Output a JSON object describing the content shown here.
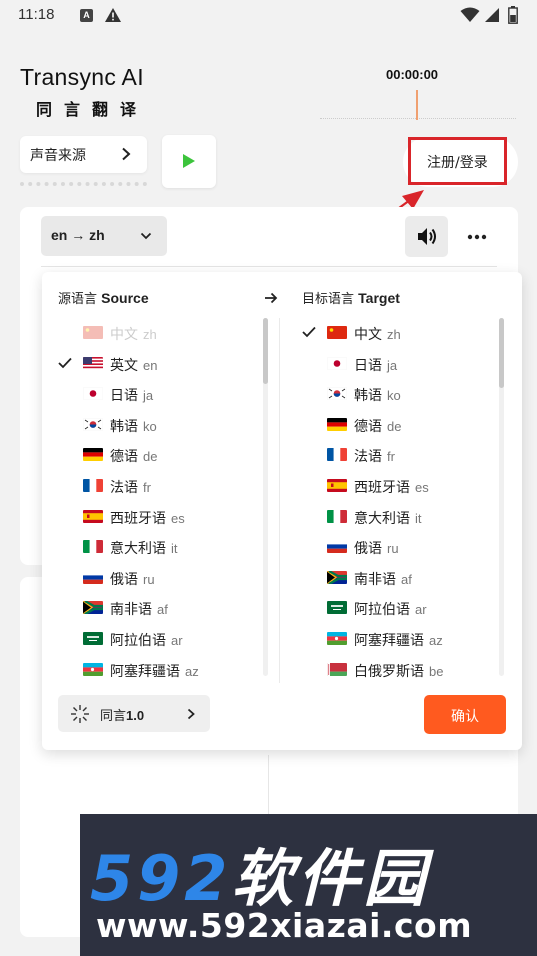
{
  "status_bar": {
    "time": "11:18",
    "notification_badge": "A",
    "icons": [
      "a-badge-icon",
      "warning-icon",
      "wifi-icon",
      "signal-icon",
      "battery-icon"
    ]
  },
  "header": {
    "title": "Transync AI",
    "subtitle": "同言翻译",
    "timer": "00:00:00"
  },
  "controls": {
    "audio_source_label": "声音来源",
    "login_label": "注册/登录"
  },
  "translation_card": {
    "language_pair": "en → zh"
  },
  "dropdown": {
    "source_heading_cn": "源语言",
    "source_heading_en": "Source",
    "target_heading_cn": "目标语言",
    "target_heading_en": "Target",
    "source_languages": [
      {
        "name": "中文",
        "code": "zh",
        "flag": "cn",
        "disabled": true,
        "selected": false
      },
      {
        "name": "英文",
        "code": "en",
        "flag": "us",
        "disabled": false,
        "selected": true
      },
      {
        "name": "日语",
        "code": "ja",
        "flag": "jp",
        "disabled": false,
        "selected": false
      },
      {
        "name": "韩语",
        "code": "ko",
        "flag": "kr",
        "disabled": false,
        "selected": false
      },
      {
        "name": "德语",
        "code": "de",
        "flag": "de",
        "disabled": false,
        "selected": false
      },
      {
        "name": "法语",
        "code": "fr",
        "flag": "fr",
        "disabled": false,
        "selected": false
      },
      {
        "name": "西班牙语",
        "code": "es",
        "flag": "es",
        "disabled": false,
        "selected": false
      },
      {
        "name": "意大利语",
        "code": "it",
        "flag": "it",
        "disabled": false,
        "selected": false
      },
      {
        "name": "俄语",
        "code": "ru",
        "flag": "ru",
        "disabled": false,
        "selected": false
      },
      {
        "name": "南非语",
        "code": "af",
        "flag": "za",
        "disabled": false,
        "selected": false
      },
      {
        "name": "阿拉伯语",
        "code": "ar",
        "flag": "sa",
        "disabled": false,
        "selected": false
      },
      {
        "name": "阿塞拜疆语",
        "code": "az",
        "flag": "az",
        "disabled": false,
        "selected": false
      }
    ],
    "target_languages": [
      {
        "name": "中文",
        "code": "zh",
        "flag": "cn",
        "disabled": false,
        "selected": true
      },
      {
        "name": "日语",
        "code": "ja",
        "flag": "jp",
        "disabled": false,
        "selected": false
      },
      {
        "name": "韩语",
        "code": "ko",
        "flag": "kr",
        "disabled": false,
        "selected": false
      },
      {
        "name": "德语",
        "code": "de",
        "flag": "de",
        "disabled": false,
        "selected": false
      },
      {
        "name": "法语",
        "code": "fr",
        "flag": "fr",
        "disabled": false,
        "selected": false
      },
      {
        "name": "西班牙语",
        "code": "es",
        "flag": "es",
        "disabled": false,
        "selected": false
      },
      {
        "name": "意大利语",
        "code": "it",
        "flag": "it",
        "disabled": false,
        "selected": false
      },
      {
        "name": "俄语",
        "code": "ru",
        "flag": "ru",
        "disabled": false,
        "selected": false
      },
      {
        "name": "南非语",
        "code": "af",
        "flag": "za",
        "disabled": false,
        "selected": false
      },
      {
        "name": "阿拉伯语",
        "code": "ar",
        "flag": "sa",
        "disabled": false,
        "selected": false
      },
      {
        "name": "阿塞拜疆语",
        "code": "az",
        "flag": "az",
        "disabled": false,
        "selected": false
      },
      {
        "name": "白俄罗斯语",
        "code": "be",
        "flag": "by",
        "disabled": false,
        "selected": false
      }
    ],
    "model_name_cn": "同言",
    "model_version": "1.0",
    "confirm_label": "确认"
  },
  "watermark": {
    "number": "592",
    "name": "软件园",
    "url": "www.592xiazai.com"
  },
  "colors": {
    "accent": "#ff5a1f",
    "play_green": "#3cc43c",
    "annotation_red": "#d9252a",
    "watermark_blue": "#2e86e8",
    "watermark_bg": "#2d3140"
  }
}
